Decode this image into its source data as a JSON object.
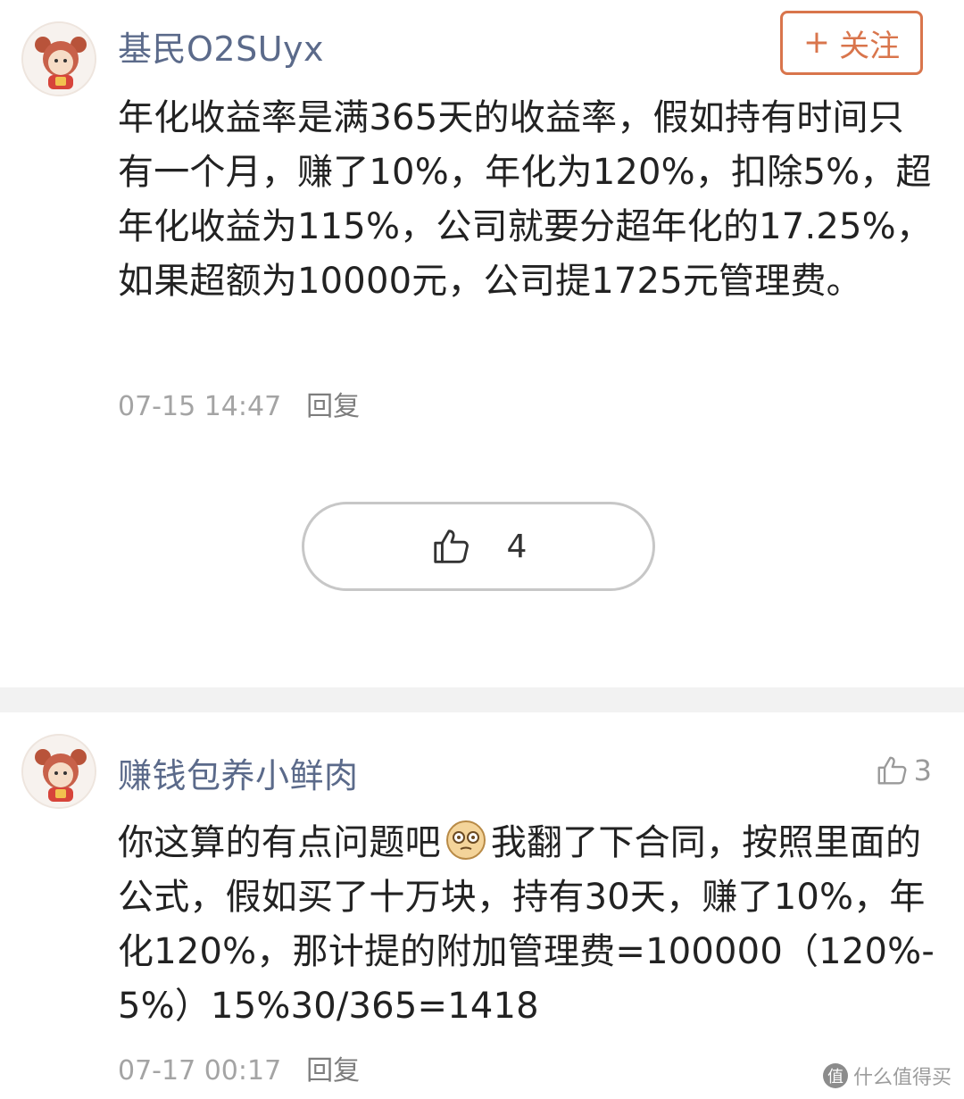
{
  "comments": [
    {
      "username": "基民O2SUyx",
      "follow_label": "关注",
      "follow_plus": "+",
      "body": "年化收益率是满365天的收益率，假如持有时间只有一个月，赚了10%，年化为120%，扣除5%，超年化收益为115%，公司就要分超年化的17.25%，如果超额为10000元，公司提1725元管理费。",
      "timestamp": "07-15 14:47",
      "reply_label": "回复",
      "likes": "4",
      "avatar_icon": "cartoon-avatar-icon"
    },
    {
      "username": "赚钱包养小鲜肉",
      "body_part1": "你这算的有点问题吧",
      "body_part2": "我翻了下合同，按照里面的公式，假如买了十万块，持有30天，赚了10%，年化120%，那计提的附加管理费=100000（120%-5%）15%30/365=1418",
      "emoji_icon": "dazed-face-emoji-icon",
      "timestamp": "07-17 00:17",
      "reply_label": "回复",
      "likes": "3",
      "avatar_icon": "cartoon-avatar-icon"
    }
  ],
  "watermark": {
    "badge": "值",
    "text": "什么值得买"
  },
  "colors": {
    "username": "#5b6a8a",
    "follow_accent": "#d9754c",
    "meta": "#a4a4a4",
    "separator": "#f2f2f2"
  }
}
